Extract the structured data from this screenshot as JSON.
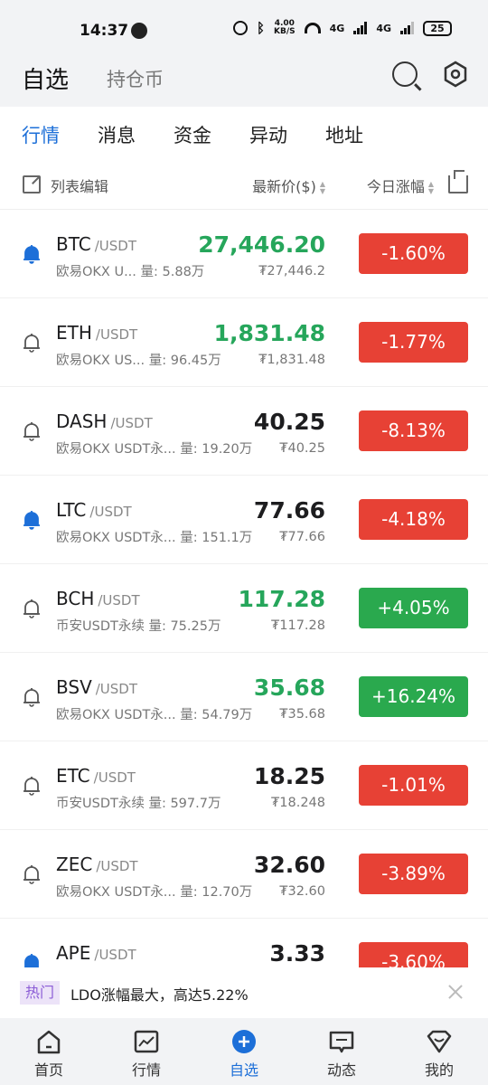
{
  "status": {
    "time": "14:37",
    "speed_value": "4.00",
    "speed_unit": "KB/S",
    "net1": "4G",
    "net2": "4G",
    "battery": "25"
  },
  "header": {
    "title": "自选",
    "subtitle": "持仓币"
  },
  "tabs": [
    {
      "label": "行情",
      "active": true
    },
    {
      "label": "消息"
    },
    {
      "label": "资金"
    },
    {
      "label": "异动"
    },
    {
      "label": "地址"
    }
  ],
  "list_header": {
    "edit": "列表编辑",
    "price": "最新价($)",
    "change": "今日涨幅"
  },
  "rows": [
    {
      "symbol": "BTC",
      "pair": "/USDT",
      "exchange": "欧易OKX U...",
      "volume": "量: 5.88万",
      "price": "27,446.20",
      "price_color": "up",
      "cny": "₮27,446.2",
      "change": "-1.60%",
      "change_dir": "down",
      "alert": true
    },
    {
      "symbol": "ETH",
      "pair": "/USDT",
      "exchange": "欧易OKX US...",
      "volume": "量: 96.45万",
      "price": "1,831.48",
      "price_color": "up",
      "cny": "₮1,831.48",
      "change": "-1.77%",
      "change_dir": "down",
      "alert": false
    },
    {
      "symbol": "DASH",
      "pair": "/USDT",
      "exchange": "欧易OKX USDT永...",
      "volume": "量: 19.20万",
      "price": "40.25",
      "price_color": "flat",
      "cny": "₮40.25",
      "change": "-8.13%",
      "change_dir": "down",
      "alert": false
    },
    {
      "symbol": "LTC",
      "pair": "/USDT",
      "exchange": "欧易OKX USDT永...",
      "volume": "量: 151.1万",
      "price": "77.66",
      "price_color": "flat",
      "cny": "₮77.66",
      "change": "-4.18%",
      "change_dir": "down",
      "alert": true
    },
    {
      "symbol": "BCH",
      "pair": "/USDT",
      "exchange": "币安USDT永续",
      "volume": "量: 75.25万",
      "price": "117.28",
      "price_color": "up",
      "cny": "₮117.28",
      "change": "+4.05%",
      "change_dir": "up",
      "alert": false
    },
    {
      "symbol": "BSV",
      "pair": "/USDT",
      "exchange": "欧易OKX USDT永...",
      "volume": "量: 54.79万",
      "price": "35.68",
      "price_color": "up",
      "cny": "₮35.68",
      "change": "+16.24%",
      "change_dir": "up",
      "alert": false
    },
    {
      "symbol": "ETC",
      "pair": "/USDT",
      "exchange": "币安USDT永续",
      "volume": "量: 597.7万",
      "price": "18.25",
      "price_color": "flat",
      "cny": "₮18.248",
      "change": "-1.01%",
      "change_dir": "down",
      "alert": false
    },
    {
      "symbol": "ZEC",
      "pair": "/USDT",
      "exchange": "欧易OKX USDT永...",
      "volume": "量: 12.70万",
      "price": "32.60",
      "price_color": "flat",
      "cny": "₮32.60",
      "change": "-3.89%",
      "change_dir": "down",
      "alert": false
    },
    {
      "symbol": "APE",
      "pair": "/USDT",
      "exchange": "",
      "volume": "",
      "price": "3.33",
      "price_color": "flat",
      "cny": "",
      "change": "-3.60%",
      "change_dir": "down",
      "alert": true
    }
  ],
  "hot": {
    "tag": "热门",
    "text": "LDO涨幅最大，高达5.22%"
  },
  "nav": [
    {
      "label": "首页",
      "icon": "home-icon"
    },
    {
      "label": "行情",
      "icon": "chart-icon"
    },
    {
      "label": "自选",
      "icon": "plus-icon",
      "active": true
    },
    {
      "label": "动态",
      "icon": "message-icon"
    },
    {
      "label": "我的",
      "icon": "profile-icon"
    }
  ],
  "colors": {
    "accent": "#1d6fd8",
    "up": "#2aa94e",
    "down": "#e74135",
    "bell_active": "#1d6fd8"
  }
}
